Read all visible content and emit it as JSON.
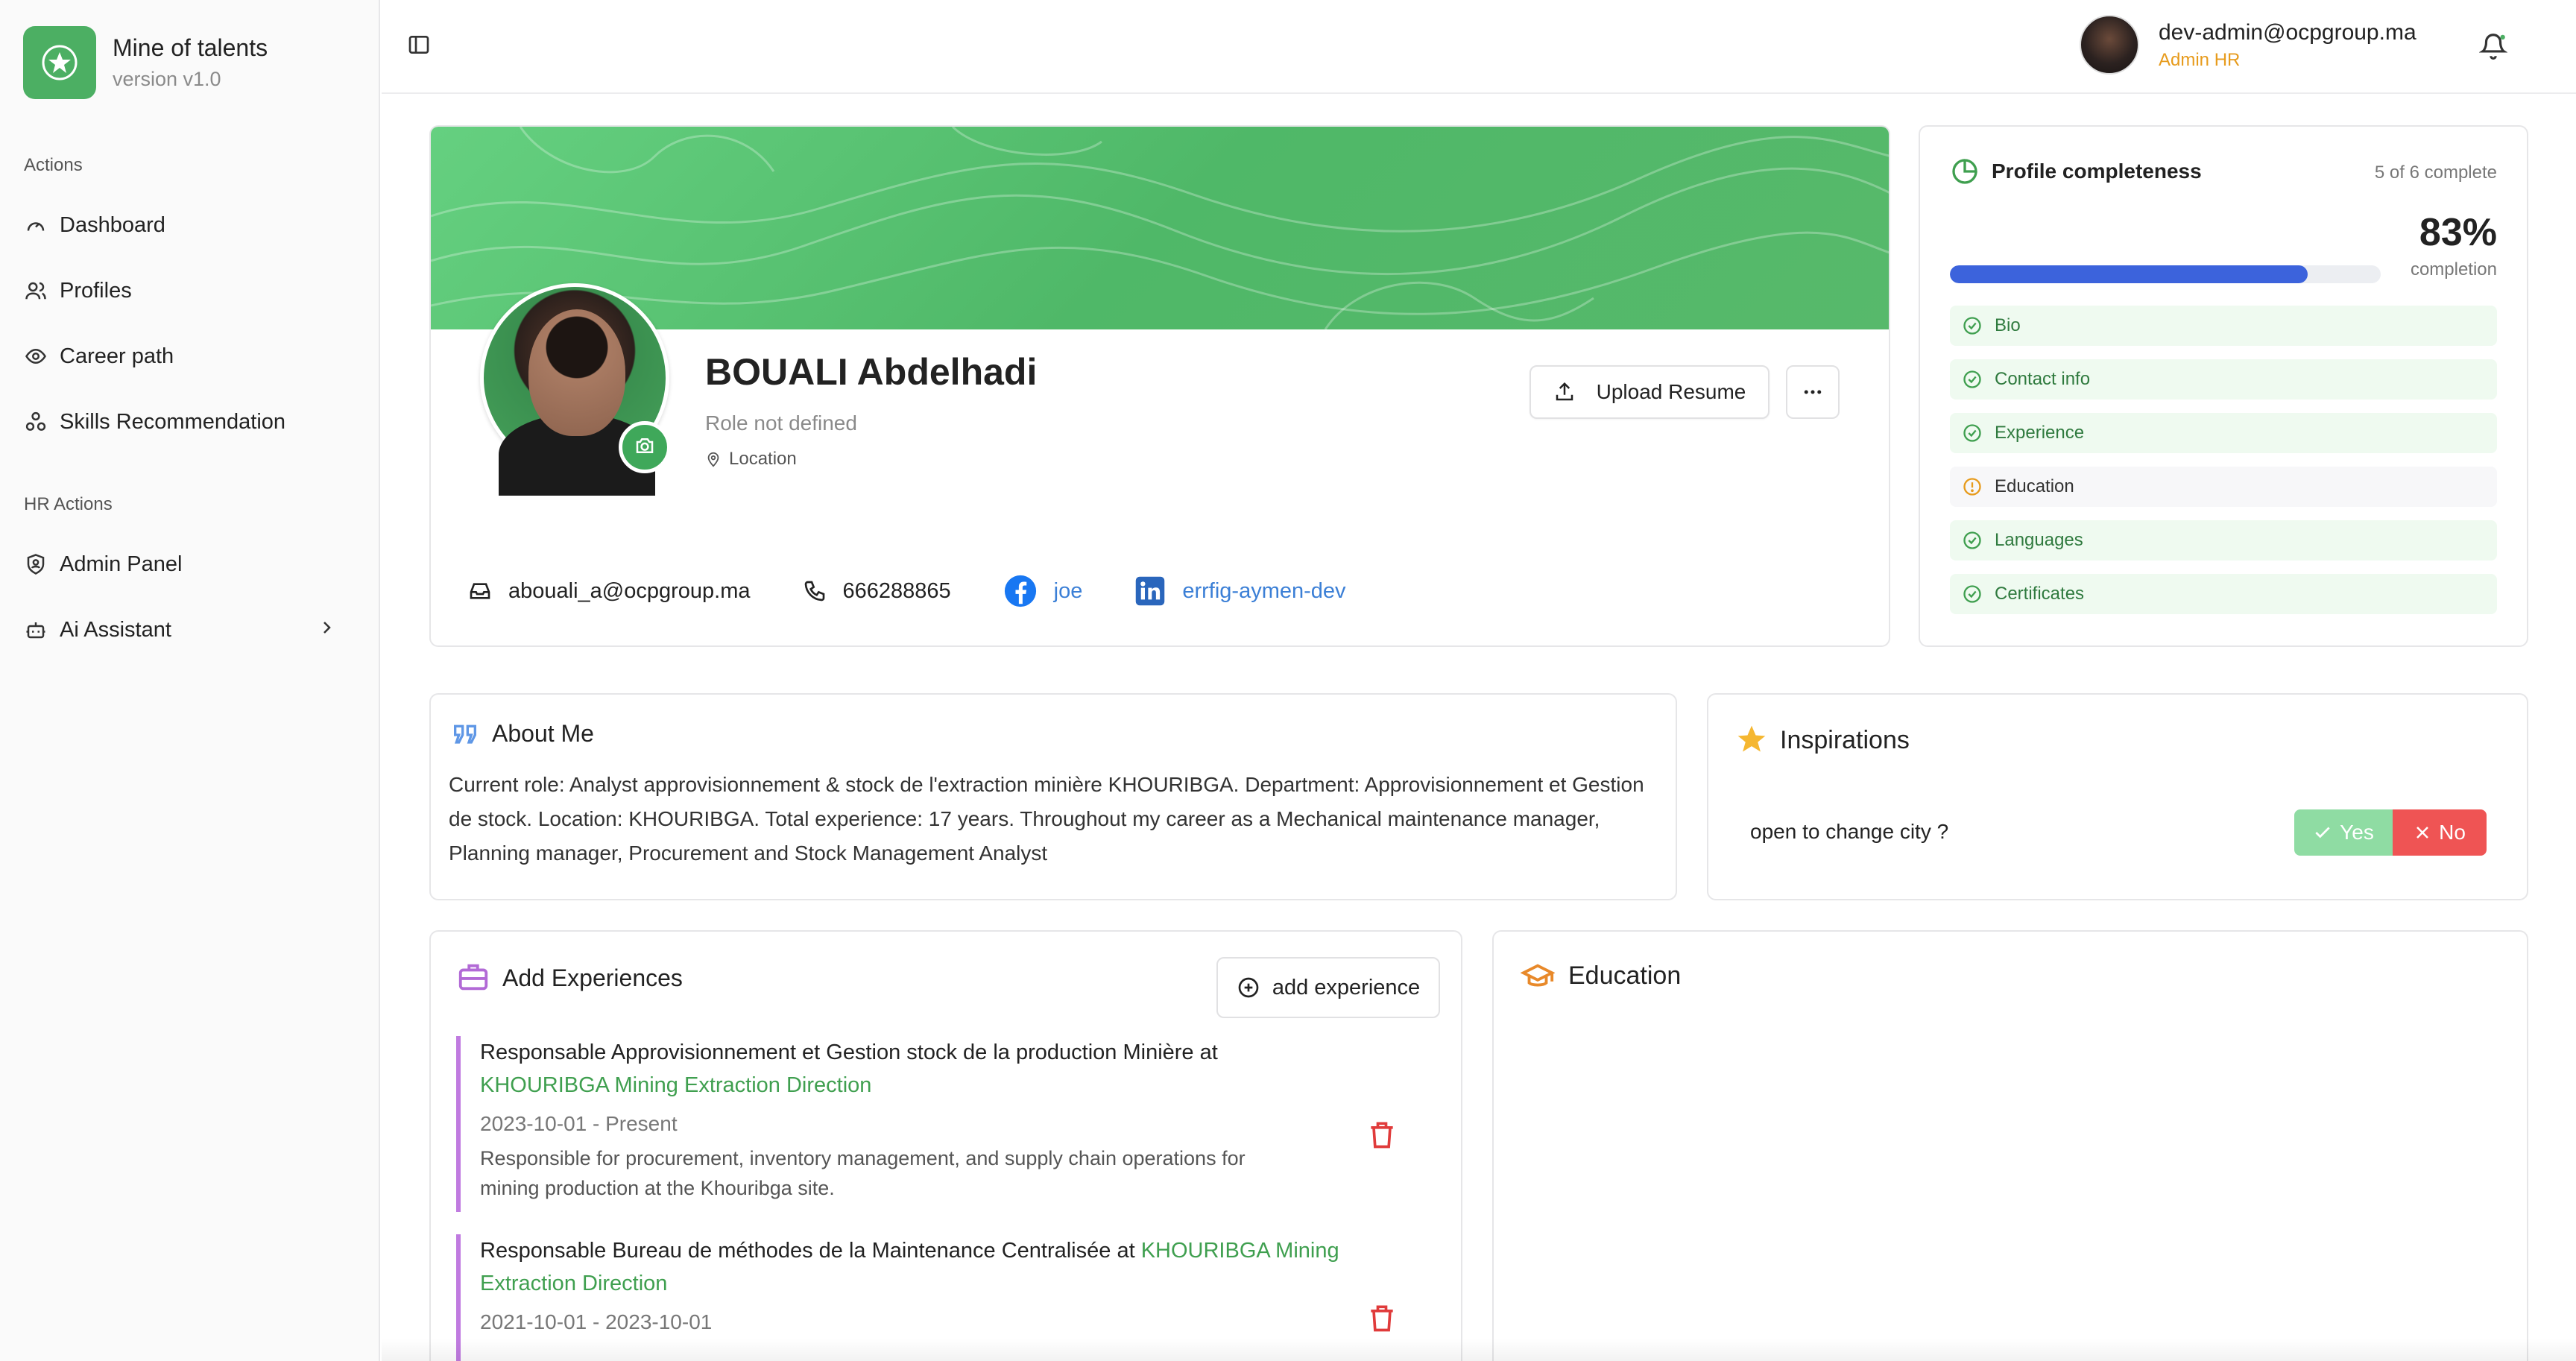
{
  "app": {
    "title": "Mine of talents",
    "version": "version v1.0"
  },
  "sidebar": {
    "actions_label": "Actions",
    "actions": [
      {
        "label": "Dashboard",
        "icon": "gauge-icon"
      },
      {
        "label": "Profiles",
        "icon": "users-icon"
      },
      {
        "label": "Career path",
        "icon": "eye-icon"
      },
      {
        "label": "Skills Recommendation",
        "icon": "network-icon"
      }
    ],
    "hr_label": "HR Actions",
    "hr_actions": [
      {
        "label": "Admin Panel",
        "icon": "shield-icon"
      },
      {
        "label": "Ai Assistant",
        "icon": "bot-icon"
      }
    ]
  },
  "header": {
    "user_email": "dev-admin@ocpgroup.ma",
    "user_role": "Admin HR"
  },
  "profile": {
    "name": "BOUALI Abdelhadi",
    "role": "Role not defined",
    "location": "Location",
    "upload_label": "Upload Resume",
    "email": "abouali_a@ocpgroup.ma",
    "phone": "666288865",
    "facebook": "joe",
    "linkedin": "errfig-aymen-dev"
  },
  "completeness": {
    "title": "Profile completeness",
    "count_text": "5 of 6 complete",
    "percent_text": "83%",
    "percent_value": 83,
    "sub": "completion",
    "items": [
      {
        "label": "Bio",
        "status": "complete"
      },
      {
        "label": "Contact info",
        "status": "complete"
      },
      {
        "label": "Experience",
        "status": "complete"
      },
      {
        "label": "Education",
        "status": "incomplete"
      },
      {
        "label": "Languages",
        "status": "complete"
      },
      {
        "label": "Certificates",
        "status": "complete"
      }
    ]
  },
  "about": {
    "title": "About Me",
    "text": "Current role: Analyst approvisionnement & stock de l'extraction minière KHOURIBGA. Department: Approvisionnement et Gestion de stock. Location: KHOURIBGA. Total experience: 17 years. Throughout my career as a Mechanical maintenance manager, Planning manager, Procurement and Stock Management Analyst"
  },
  "inspirations": {
    "title": "Inspirations",
    "question": "open to change city ?",
    "yes": "Yes",
    "no": "No"
  },
  "experiences": {
    "title": "Add Experiences",
    "add_label": "add experience",
    "items": [
      {
        "title": "Responsable Approvisionnement et Gestion stock de la production Minière at",
        "company": "KHOURIBGA Mining Extraction Direction",
        "dates": "2023-10-01 - Present",
        "description": "Responsible for procurement, inventory management, and supply chain operations for mining production at the Khouribga site."
      },
      {
        "title": "Responsable Bureau de méthodes de la Maintenance Centralisée at",
        "company": "KHOURIBGA Mining Extraction Direction",
        "dates": "2021-10-01 - 2023-10-01",
        "description": ""
      }
    ]
  },
  "education": {
    "title": "Education"
  },
  "colors": {
    "brand_green": "#4caf63",
    "accent_orange": "#e79b1c",
    "progress_blue": "#3c63dc",
    "danger_red": "#ef5454",
    "experience_purple": "#c07be0"
  }
}
